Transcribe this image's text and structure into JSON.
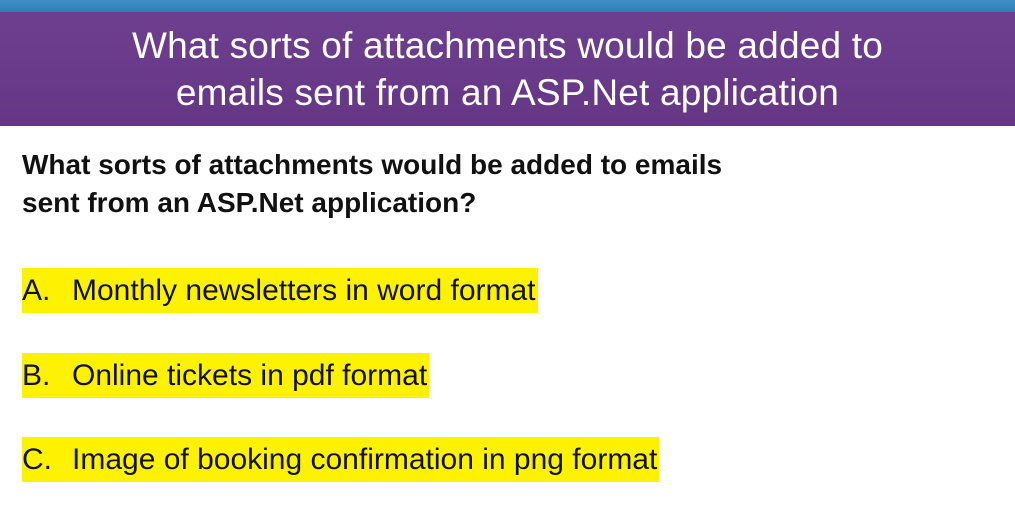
{
  "colors": {
    "top_stripe": "#2f7fb6",
    "title_background": "#6a3b8b",
    "option_highlight": "#fff200"
  },
  "title": {
    "line1": "What sorts of attachments would be added to",
    "line2": "emails sent from an ASP.Net application"
  },
  "question": {
    "line1": "What sorts of attachments would be added to emails",
    "line2": "sent from an ASP.Net application?"
  },
  "options": [
    {
      "letter": "A.",
      "text": "Monthly newsletters in word format"
    },
    {
      "letter": "B.",
      "text": "Online tickets in pdf format"
    },
    {
      "letter": "C.",
      "text": "Image of booking confirmation in png format"
    }
  ]
}
